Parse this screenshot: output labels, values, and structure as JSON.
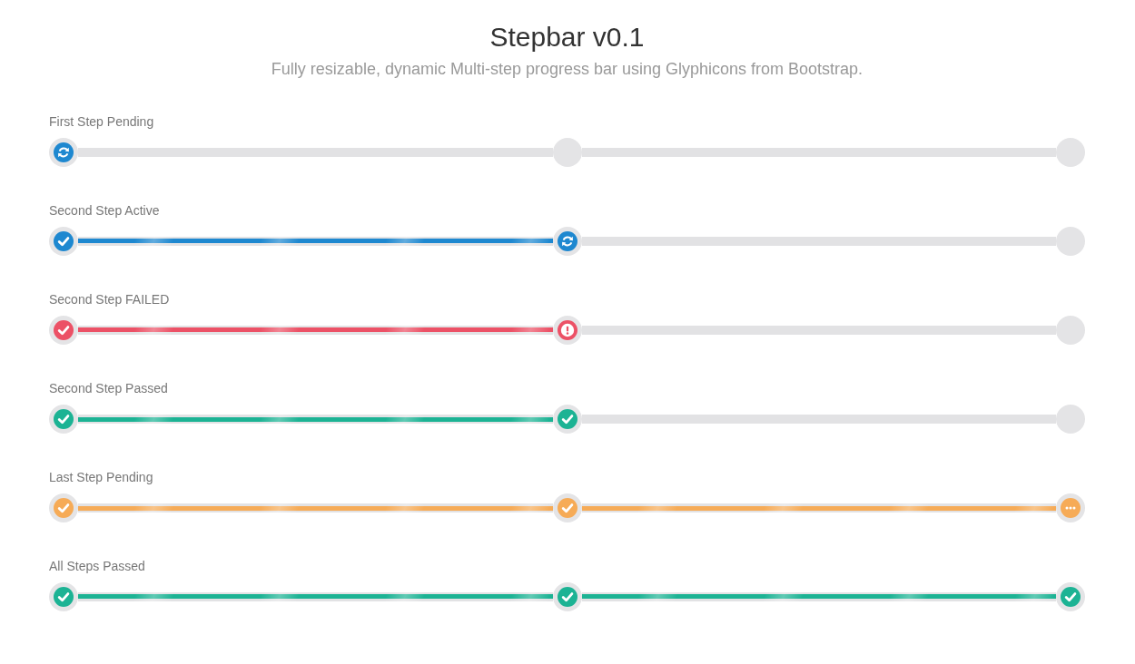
{
  "header": {
    "title": "Stepbar v0.1",
    "subtitle": "Fully resizable, dynamic Multi-step progress bar using Glyphicons from Bootstrap."
  },
  "stepbars": [
    {
      "label": "First Step Pending",
      "color": "#1e88d0",
      "steps": [
        {
          "kind": "active"
        },
        {
          "kind": "todo"
        },
        {
          "kind": "todo"
        }
      ],
      "segments": [
        {
          "filled": false
        },
        {
          "filled": false
        }
      ]
    },
    {
      "label": "Second Step Active",
      "color": "#1e88d0",
      "steps": [
        {
          "kind": "done"
        },
        {
          "kind": "active"
        },
        {
          "kind": "todo"
        }
      ],
      "segments": [
        {
          "filled": true
        },
        {
          "filled": false
        }
      ]
    },
    {
      "label": "Second Step FAILED",
      "color": "#ec5166",
      "steps": [
        {
          "kind": "done"
        },
        {
          "kind": "failed"
        },
        {
          "kind": "todo"
        }
      ],
      "segments": [
        {
          "filled": true
        },
        {
          "filled": false
        }
      ]
    },
    {
      "label": "Second Step Passed",
      "color": "#1cb394",
      "steps": [
        {
          "kind": "done"
        },
        {
          "kind": "done"
        },
        {
          "kind": "todo"
        }
      ],
      "segments": [
        {
          "filled": true
        },
        {
          "filled": false
        }
      ]
    },
    {
      "label": "Last Step Pending",
      "color": "#f6ab57",
      "steps": [
        {
          "kind": "done"
        },
        {
          "kind": "done"
        },
        {
          "kind": "waiting"
        }
      ],
      "segments": [
        {
          "filled": true
        },
        {
          "filled": true
        }
      ]
    },
    {
      "label": "All Steps Passed",
      "color": "#1cb394",
      "steps": [
        {
          "kind": "done"
        },
        {
          "kind": "done"
        },
        {
          "kind": "done"
        }
      ],
      "segments": [
        {
          "filled": true
        },
        {
          "filled": true
        }
      ]
    }
  ]
}
